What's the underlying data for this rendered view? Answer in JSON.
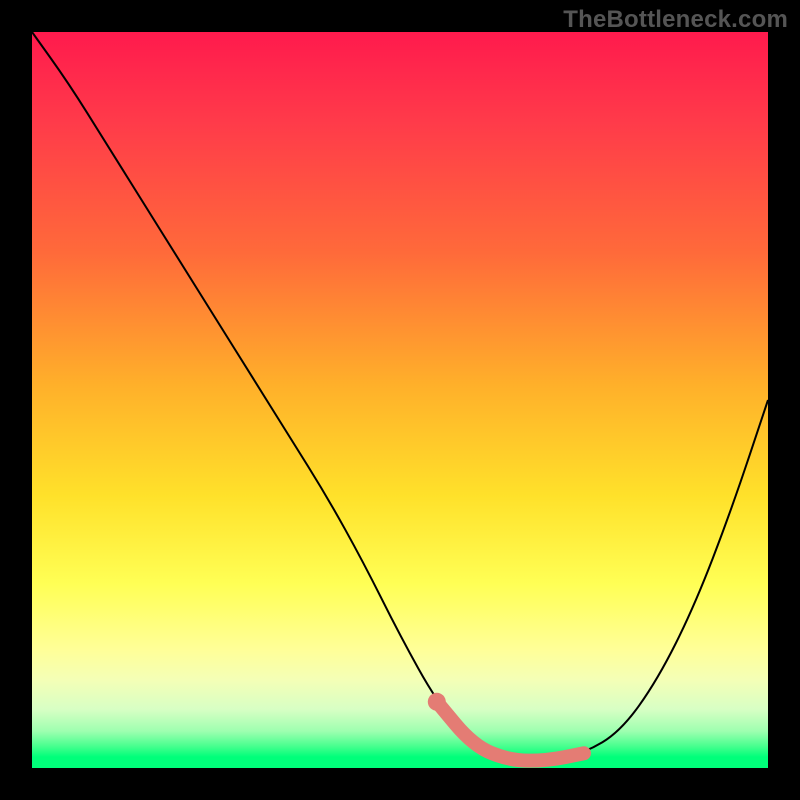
{
  "watermark": "TheBottleneck.com",
  "chart_data": {
    "type": "line",
    "title": "",
    "xlabel": "",
    "ylabel": "",
    "xlim": [
      0,
      100
    ],
    "ylim": [
      0,
      100
    ],
    "grid": false,
    "series": [
      {
        "name": "curve",
        "x": [
          0,
          5,
          10,
          15,
          20,
          25,
          30,
          35,
          40,
          45,
          50,
          55,
          60,
          65,
          70,
          75,
          80,
          85,
          90,
          95,
          100
        ],
        "values": [
          100,
          93,
          85,
          77,
          69,
          61,
          53,
          45,
          37,
          28,
          18,
          9,
          3,
          1,
          1,
          2,
          5,
          12,
          22,
          35,
          50
        ]
      }
    ],
    "highlight": {
      "name": "bottleneck-range",
      "color": "#e47c74",
      "x": [
        55,
        60,
        65,
        70,
        75
      ],
      "values": [
        9,
        3,
        1,
        1,
        2
      ]
    },
    "background_gradient": {
      "direction": "vertical",
      "stops": [
        {
          "pos": 0.0,
          "color": "#ff1a4d"
        },
        {
          "pos": 0.3,
          "color": "#ff6a3a"
        },
        {
          "pos": 0.63,
          "color": "#ffe12a"
        },
        {
          "pos": 0.84,
          "color": "#ffff99"
        },
        {
          "pos": 0.95,
          "color": "#9effb0"
        },
        {
          "pos": 1.0,
          "color": "#00ff7a"
        }
      ]
    }
  }
}
